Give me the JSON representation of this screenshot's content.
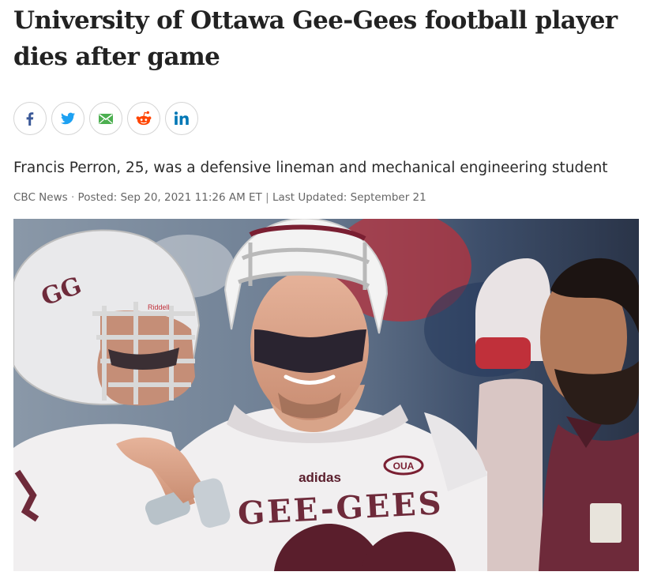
{
  "article": {
    "headline": "University of Ottawa Gee-Gees football player dies after game",
    "deck": "Francis Perron, 25, was a defensive lineman and mechanical engineering student",
    "byline": {
      "source": "CBC News",
      "separator_dot": " · ",
      "posted": "Posted: Sep 20, 2021 11:26 AM ET",
      "separator_bar": " | ",
      "updated": "Last Updated: September 21"
    }
  },
  "share": {
    "buttons": [
      {
        "icon": "facebook-icon",
        "color": "#3b5998"
      },
      {
        "icon": "twitter-icon",
        "color": "#1da1f2"
      },
      {
        "icon": "email-icon",
        "color": "#4caf50"
      },
      {
        "icon": "reddit-icon",
        "color": "#ff4500"
      },
      {
        "icon": "linkedin-icon",
        "color": "#0077b5"
      }
    ]
  },
  "photo": {
    "jersey_brand": "adidas",
    "jersey_patch": "OUA",
    "jersey_text": "GEE-GEES",
    "helmet_text": "GG",
    "helmet_sticker": "Riddell"
  },
  "colors": {
    "garnet": "#6e2a3a",
    "jersey_white": "#f1eff0",
    "headline": "#222222",
    "meta_text": "#666666"
  }
}
